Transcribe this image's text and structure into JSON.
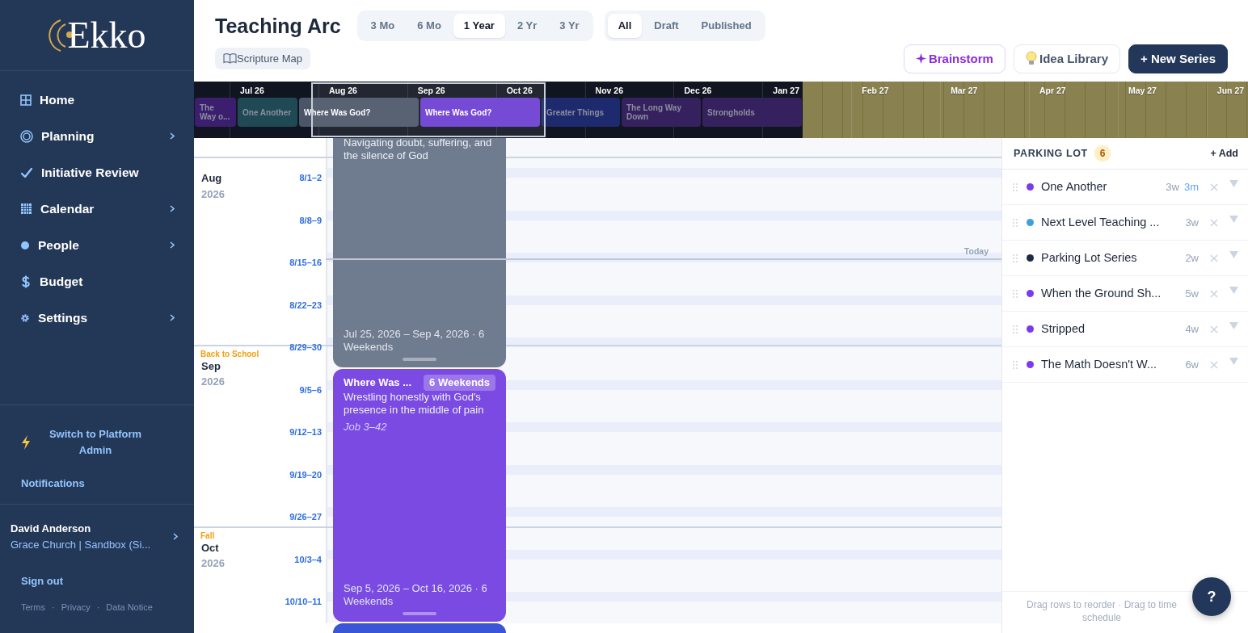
{
  "sidebar": {
    "logo": "Ekko",
    "nav": [
      {
        "label": "Home",
        "has_submenu": false
      },
      {
        "label": "Planning",
        "has_submenu": true
      },
      {
        "label": "Initiative Review",
        "has_submenu": false
      },
      {
        "label": "Calendar",
        "has_submenu": true
      },
      {
        "label": "People",
        "has_submenu": true
      },
      {
        "label": "Budget",
        "has_submenu": false
      },
      {
        "label": "Settings",
        "has_submenu": true
      }
    ],
    "switch_admin": "Switch to Platform Admin",
    "notifications": "Notifications",
    "user": {
      "name": "David Anderson",
      "org": "Grace Church | Sandbox (Si..."
    },
    "sign_out": "Sign out",
    "footer_links": [
      "Terms",
      "Privacy",
      "Data Notice"
    ],
    "footer_separator": "·"
  },
  "header": {
    "title": "Teaching Arc",
    "ranges": [
      {
        "label": "3 Mo",
        "selected": false
      },
      {
        "label": "6 Mo",
        "selected": false
      },
      {
        "label": "1 Year",
        "selected": true
      },
      {
        "label": "2 Yr",
        "selected": false
      },
      {
        "label": "3 Yr",
        "selected": false
      }
    ],
    "filters": [
      {
        "label": "All",
        "selected": true
      },
      {
        "label": "Draft",
        "selected": false
      },
      {
        "label": "Published",
        "selected": false
      }
    ],
    "scripture_map": "Scripture Map",
    "actions": [
      {
        "label": "Brainstorm",
        "kind": "brainstorm"
      },
      {
        "label": "Idea Library",
        "kind": "library"
      },
      {
        "label": "+ New Series",
        "kind": "primary"
      }
    ]
  },
  "minimap": {
    "months": [
      "Jul 26",
      "Aug 26",
      "Sep 26",
      "Oct 26",
      "Nov 26",
      "Dec 26",
      "Jan 27",
      "Feb 27",
      "Mar 27",
      "Apr 27",
      "May 27",
      "Jun 27"
    ],
    "series": [
      {
        "label": "The Way o...",
        "color": "#3b1f6e",
        "dimmed": true
      },
      {
        "label": "One Another",
        "color": "#1f4a55",
        "dimmed": true
      },
      {
        "label": "Where Was God?",
        "color": "#4b5568",
        "dimmed": false
      },
      {
        "label": "Where Was God?",
        "color": "#6a3bd1",
        "dimmed": false
      },
      {
        "label": "Greater Things",
        "color": "#1e2a6e",
        "dimmed": true
      },
      {
        "label": "The Long Way Down",
        "color": "#36215f",
        "dimmed": true
      },
      {
        "label": "Strongholds",
        "color": "#36215f",
        "dimmed": true
      }
    ]
  },
  "timeline": {
    "months": [
      {
        "name": "Aug",
        "year": "2026"
      },
      {
        "name": "Sep",
        "year": "2026",
        "season": "Back to School"
      },
      {
        "name": "Oct",
        "year": "2026",
        "season": "Fall"
      }
    ],
    "weeks": [
      "8/1–2",
      "8/8–9",
      "8/15–16",
      "8/22–23",
      "8/29–30",
      "9/5–6",
      "9/12–13",
      "9/19–20",
      "9/26–27",
      "10/3–4",
      "10/10–11"
    ],
    "today_label": "Today",
    "cards": [
      {
        "color": "#6f7b8e",
        "description": "Navigating doubt, suffering, and the silence of God",
        "dates": "Jul 25, 2026 – Sep 4, 2026 · 6 Weekends"
      },
      {
        "color": "#7a4ae2",
        "title": "Where Was ...",
        "badge": "6 Weekends",
        "description": "Wrestling honestly with God's presence in the middle of pain",
        "scripture": "Job 3–42",
        "dates": "Sep 5, 2026 – Oct 16, 2026 · 6 Weekends"
      },
      {
        "color": "#3b55d9"
      }
    ]
  },
  "parking_lot": {
    "title": "PARKING LOT",
    "count": "6",
    "add": "+ Add",
    "items": [
      {
        "name": "One Another",
        "color": "#7c3aed",
        "duration": "3w",
        "extra": "3m"
      },
      {
        "name": "Next Level Teaching ...",
        "color": "#3ea0e0",
        "duration": "3w"
      },
      {
        "name": "Parking Lot Series",
        "color": "#1e2a44",
        "duration": "2w"
      },
      {
        "name": "When the Ground Sh...",
        "color": "#7c3aed",
        "duration": "5w"
      },
      {
        "name": "Stripped",
        "color": "#7c3aed",
        "duration": "4w"
      },
      {
        "name": "The Math Doesn't W...",
        "color": "#7c3aed",
        "duration": "6w"
      }
    ],
    "hint_lines": [
      "Drag rows to reorder · Drag to time",
      "schedule"
    ]
  },
  "help": "?"
}
